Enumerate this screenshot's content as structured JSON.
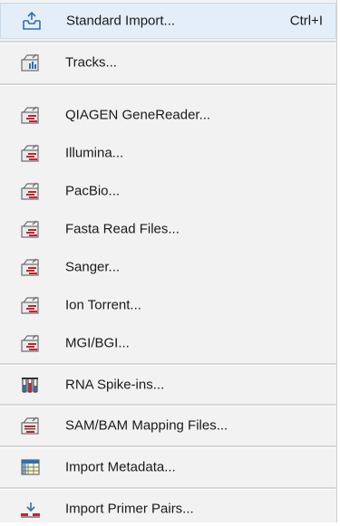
{
  "menu": {
    "items": [
      {
        "label": "Standard Import...",
        "shortcut": "Ctrl+I",
        "icon": "standard-import-icon"
      },
      {
        "label": "Tracks...",
        "icon": "tracks-import-icon"
      },
      {
        "label": "QIAGEN GeneReader...",
        "icon": "reads-import-icon"
      },
      {
        "label": "Illumina...",
        "icon": "reads-import-icon"
      },
      {
        "label": "PacBio...",
        "icon": "reads-import-icon"
      },
      {
        "label": "Fasta Read Files...",
        "icon": "reads-import-icon"
      },
      {
        "label": "Sanger...",
        "icon": "reads-import-icon"
      },
      {
        "label": "Ion Torrent...",
        "icon": "reads-import-icon"
      },
      {
        "label": "MGI/BGI...",
        "icon": "reads-import-icon"
      },
      {
        "label": "RNA Spike-ins...",
        "icon": "rna-spike-ins-icon"
      },
      {
        "label": "SAM/BAM Mapping Files...",
        "icon": "mapping-import-icon"
      },
      {
        "label": "Import Metadata...",
        "icon": "metadata-import-icon"
      },
      {
        "label": "Import Primer Pairs...",
        "icon": "primer-pairs-import-icon"
      }
    ]
  },
  "colors": {
    "highlight_bg": "#e3eef8",
    "highlight_border": "#c5dbf0",
    "menu_bg": "#f2f2f2",
    "icon_blue": "#2f6fb6",
    "icon_red": "#c0282d"
  }
}
